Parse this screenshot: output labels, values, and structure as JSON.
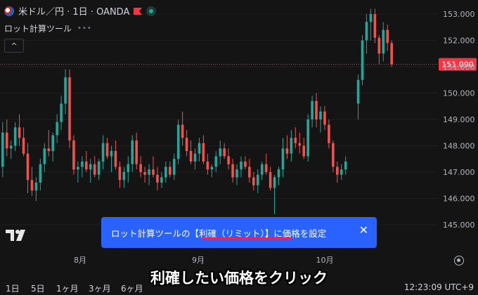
{
  "header": {
    "symbol_title": "米ドル／円 · 1日 · OANDA",
    "indicator_name": "ロット計算ツール",
    "indicator_dots": "•••",
    "collapse_glyph": "^"
  },
  "toast": {
    "text": "ロット計算ツールの【利確（リミット）】に価格を設定",
    "close": "✕"
  },
  "caption": "利確したい価格をクリック",
  "bottom_bar": {
    "timeframes": [
      "1日",
      "5日",
      "1ヶ月",
      "3ヶ月",
      "6ヶ月"
    ],
    "clock": "12:23:09 UTC+9"
  },
  "colors": {
    "up": "#26a69a",
    "down": "#ef5350",
    "toast": "#2962ff",
    "price_label": "#f23645"
  },
  "chart_data": {
    "type": "candlestick",
    "y_ticks": [
      "153.000",
      "152.000",
      "151.000",
      "150.000",
      "149.000",
      "148.000",
      "147.000",
      "146.000",
      "145.000"
    ],
    "x_ticks": [
      "8月",
      "9月",
      "10月"
    ],
    "last_price": "151.090",
    "ylim": [
      144.2,
      153.4
    ],
    "candles": [
      [
        147.2,
        148.9,
        146.8,
        148.5
      ],
      [
        148.5,
        149.0,
        147.6,
        147.9
      ],
      [
        147.9,
        148.2,
        147.5,
        148.0
      ],
      [
        148.0,
        148.9,
        147.8,
        148.7
      ],
      [
        148.7,
        149.2,
        148.0,
        148.3
      ],
      [
        148.3,
        148.7,
        147.6,
        147.7
      ],
      [
        147.7,
        148.1,
        146.2,
        146.7
      ],
      [
        146.7,
        147.2,
        146.1,
        146.3
      ],
      [
        146.3,
        146.8,
        145.9,
        146.6
      ],
      [
        146.6,
        147.5,
        146.3,
        147.3
      ],
      [
        147.3,
        148.1,
        147.0,
        147.9
      ],
      [
        147.9,
        148.6,
        147.6,
        147.8
      ],
      [
        147.8,
        148.5,
        147.4,
        148.4
      ],
      [
        148.4,
        149.2,
        148.1,
        148.9
      ],
      [
        148.9,
        149.9,
        148.6,
        149.6
      ],
      [
        149.6,
        150.9,
        149.2,
        150.6
      ],
      [
        150.6,
        150.9,
        147.9,
        148.2
      ],
      [
        148.2,
        148.4,
        146.9,
        147.1
      ],
      [
        147.1,
        147.4,
        146.6,
        147.2
      ],
      [
        147.2,
        147.6,
        146.8,
        147.4
      ],
      [
        147.4,
        147.8,
        147.0,
        147.1
      ],
      [
        147.1,
        147.5,
        146.6,
        147.3
      ],
      [
        147.3,
        147.6,
        146.8,
        146.9
      ],
      [
        146.9,
        147.5,
        146.7,
        147.4
      ],
      [
        147.4,
        148.4,
        147.1,
        148.1
      ],
      [
        148.1,
        148.3,
        147.5,
        147.6
      ],
      [
        147.6,
        148.0,
        147.0,
        147.8
      ],
      [
        147.8,
        148.2,
        147.1,
        147.2
      ],
      [
        147.2,
        147.4,
        146.4,
        146.7
      ],
      [
        146.7,
        147.2,
        146.4,
        147.0
      ],
      [
        147.0,
        147.6,
        146.6,
        147.3
      ],
      [
        147.3,
        148.4,
        147.0,
        148.2
      ],
      [
        148.2,
        148.5,
        147.1,
        147.3
      ],
      [
        147.3,
        147.6,
        146.8,
        147.0
      ],
      [
        147.0,
        147.2,
        146.6,
        146.9
      ],
      [
        146.9,
        147.3,
        146.5,
        147.1
      ],
      [
        147.1,
        147.6,
        146.8,
        146.9
      ],
      [
        146.9,
        147.2,
        146.3,
        146.6
      ],
      [
        146.6,
        147.0,
        146.4,
        146.8
      ],
      [
        146.8,
        147.4,
        146.6,
        147.2
      ],
      [
        147.2,
        147.4,
        146.8,
        146.9
      ],
      [
        146.9,
        147.7,
        146.7,
        147.5
      ],
      [
        147.5,
        149.0,
        147.3,
        148.8
      ],
      [
        148.8,
        149.3,
        148.0,
        148.3
      ],
      [
        148.3,
        148.6,
        147.6,
        147.8
      ],
      [
        147.8,
        148.2,
        147.3,
        147.4
      ],
      [
        147.4,
        147.9,
        147.1,
        147.7
      ],
      [
        147.7,
        148.3,
        147.4,
        148.1
      ],
      [
        148.1,
        148.4,
        147.3,
        147.4
      ],
      [
        147.4,
        147.7,
        146.9,
        147.1
      ],
      [
        147.1,
        147.3,
        146.8,
        147.2
      ],
      [
        147.2,
        147.8,
        147.0,
        147.6
      ],
      [
        147.6,
        148.2,
        147.3,
        147.9
      ],
      [
        147.9,
        148.1,
        147.5,
        147.6
      ],
      [
        147.6,
        147.9,
        147.1,
        147.3
      ],
      [
        147.3,
        147.5,
        146.6,
        146.8
      ],
      [
        146.8,
        147.3,
        146.5,
        147.1
      ],
      [
        147.1,
        147.6,
        146.8,
        147.4
      ],
      [
        147.4,
        147.6,
        147.1,
        147.2
      ],
      [
        147.2,
        147.5,
        146.6,
        146.8
      ],
      [
        146.8,
        147.0,
        146.3,
        146.5
      ],
      [
        146.5,
        147.1,
        146.2,
        146.9
      ],
      [
        146.9,
        147.4,
        146.7,
        147.3
      ],
      [
        147.3,
        147.7,
        146.9,
        147.0
      ],
      [
        147.0,
        147.2,
        146.3,
        146.4
      ],
      [
        146.4,
        146.9,
        145.4,
        146.8
      ],
      [
        146.8,
        147.2,
        146.5,
        147.1
      ],
      [
        147.1,
        148.3,
        146.8,
        147.9
      ],
      [
        147.9,
        148.4,
        147.5,
        147.7
      ],
      [
        147.7,
        148.6,
        147.4,
        148.3
      ],
      [
        148.3,
        148.7,
        147.9,
        148.1
      ],
      [
        148.1,
        148.5,
        147.7,
        148.0
      ],
      [
        148.0,
        148.3,
        147.5,
        147.6
      ],
      [
        147.6,
        149.2,
        147.4,
        149.0
      ],
      [
        149.0,
        149.9,
        148.7,
        149.7
      ],
      [
        149.7,
        150.0,
        148.7,
        149.0
      ],
      [
        149.0,
        149.5,
        148.5,
        149.3
      ],
      [
        149.3,
        149.5,
        148.6,
        148.8
      ],
      [
        148.8,
        149.0,
        147.9,
        148.1
      ],
      [
        148.1,
        148.2,
        147.0,
        147.2
      ],
      [
        147.2,
        147.4,
        146.6,
        146.9
      ],
      [
        146.9,
        147.3,
        146.7,
        147.1
      ],
      [
        147.1,
        147.6,
        146.9,
        147.4
      ],
      null,
      null,
      [
        149.6,
        150.7,
        149.0,
        150.5
      ],
      [
        150.5,
        152.2,
        150.3,
        152.0
      ],
      [
        152.0,
        153.0,
        151.5,
        152.7
      ],
      [
        152.7,
        153.2,
        152.0,
        153.0
      ],
      [
        153.0,
        153.2,
        151.9,
        152.1
      ],
      [
        152.1,
        152.2,
        151.1,
        151.5
      ],
      [
        151.5,
        152.7,
        151.2,
        152.4
      ],
      [
        152.4,
        152.6,
        151.6,
        151.9
      ],
      [
        151.9,
        152.0,
        151.0,
        151.1
      ]
    ]
  }
}
